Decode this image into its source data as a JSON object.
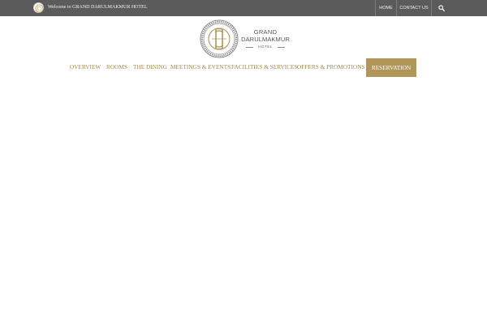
{
  "topbar": {
    "welcome_text": "Welcome to GRAND DARULMAKMUR HOTEL",
    "home_label": "HOME",
    "contact_label": "CONTACT US",
    "search_icon": "search-icon",
    "background_color": "#5b5b5b"
  },
  "logo": {
    "line1": "GRAND",
    "line2": "DARULMAKMUR",
    "line3": "HOTEL"
  },
  "nav": {
    "items": [
      {
        "label": "OVERVIEW"
      },
      {
        "label": "ROOMS"
      },
      {
        "label": "THE DINING"
      },
      {
        "label": "MEETINGS & EVENTS"
      },
      {
        "label": "FACILITIES & SERVICES"
      },
      {
        "label": "OFFERS & PROMOTIONS"
      }
    ],
    "reservation_label": "RESERVATION",
    "text_color": "#a08a4a",
    "accent_color": "#b09658"
  }
}
